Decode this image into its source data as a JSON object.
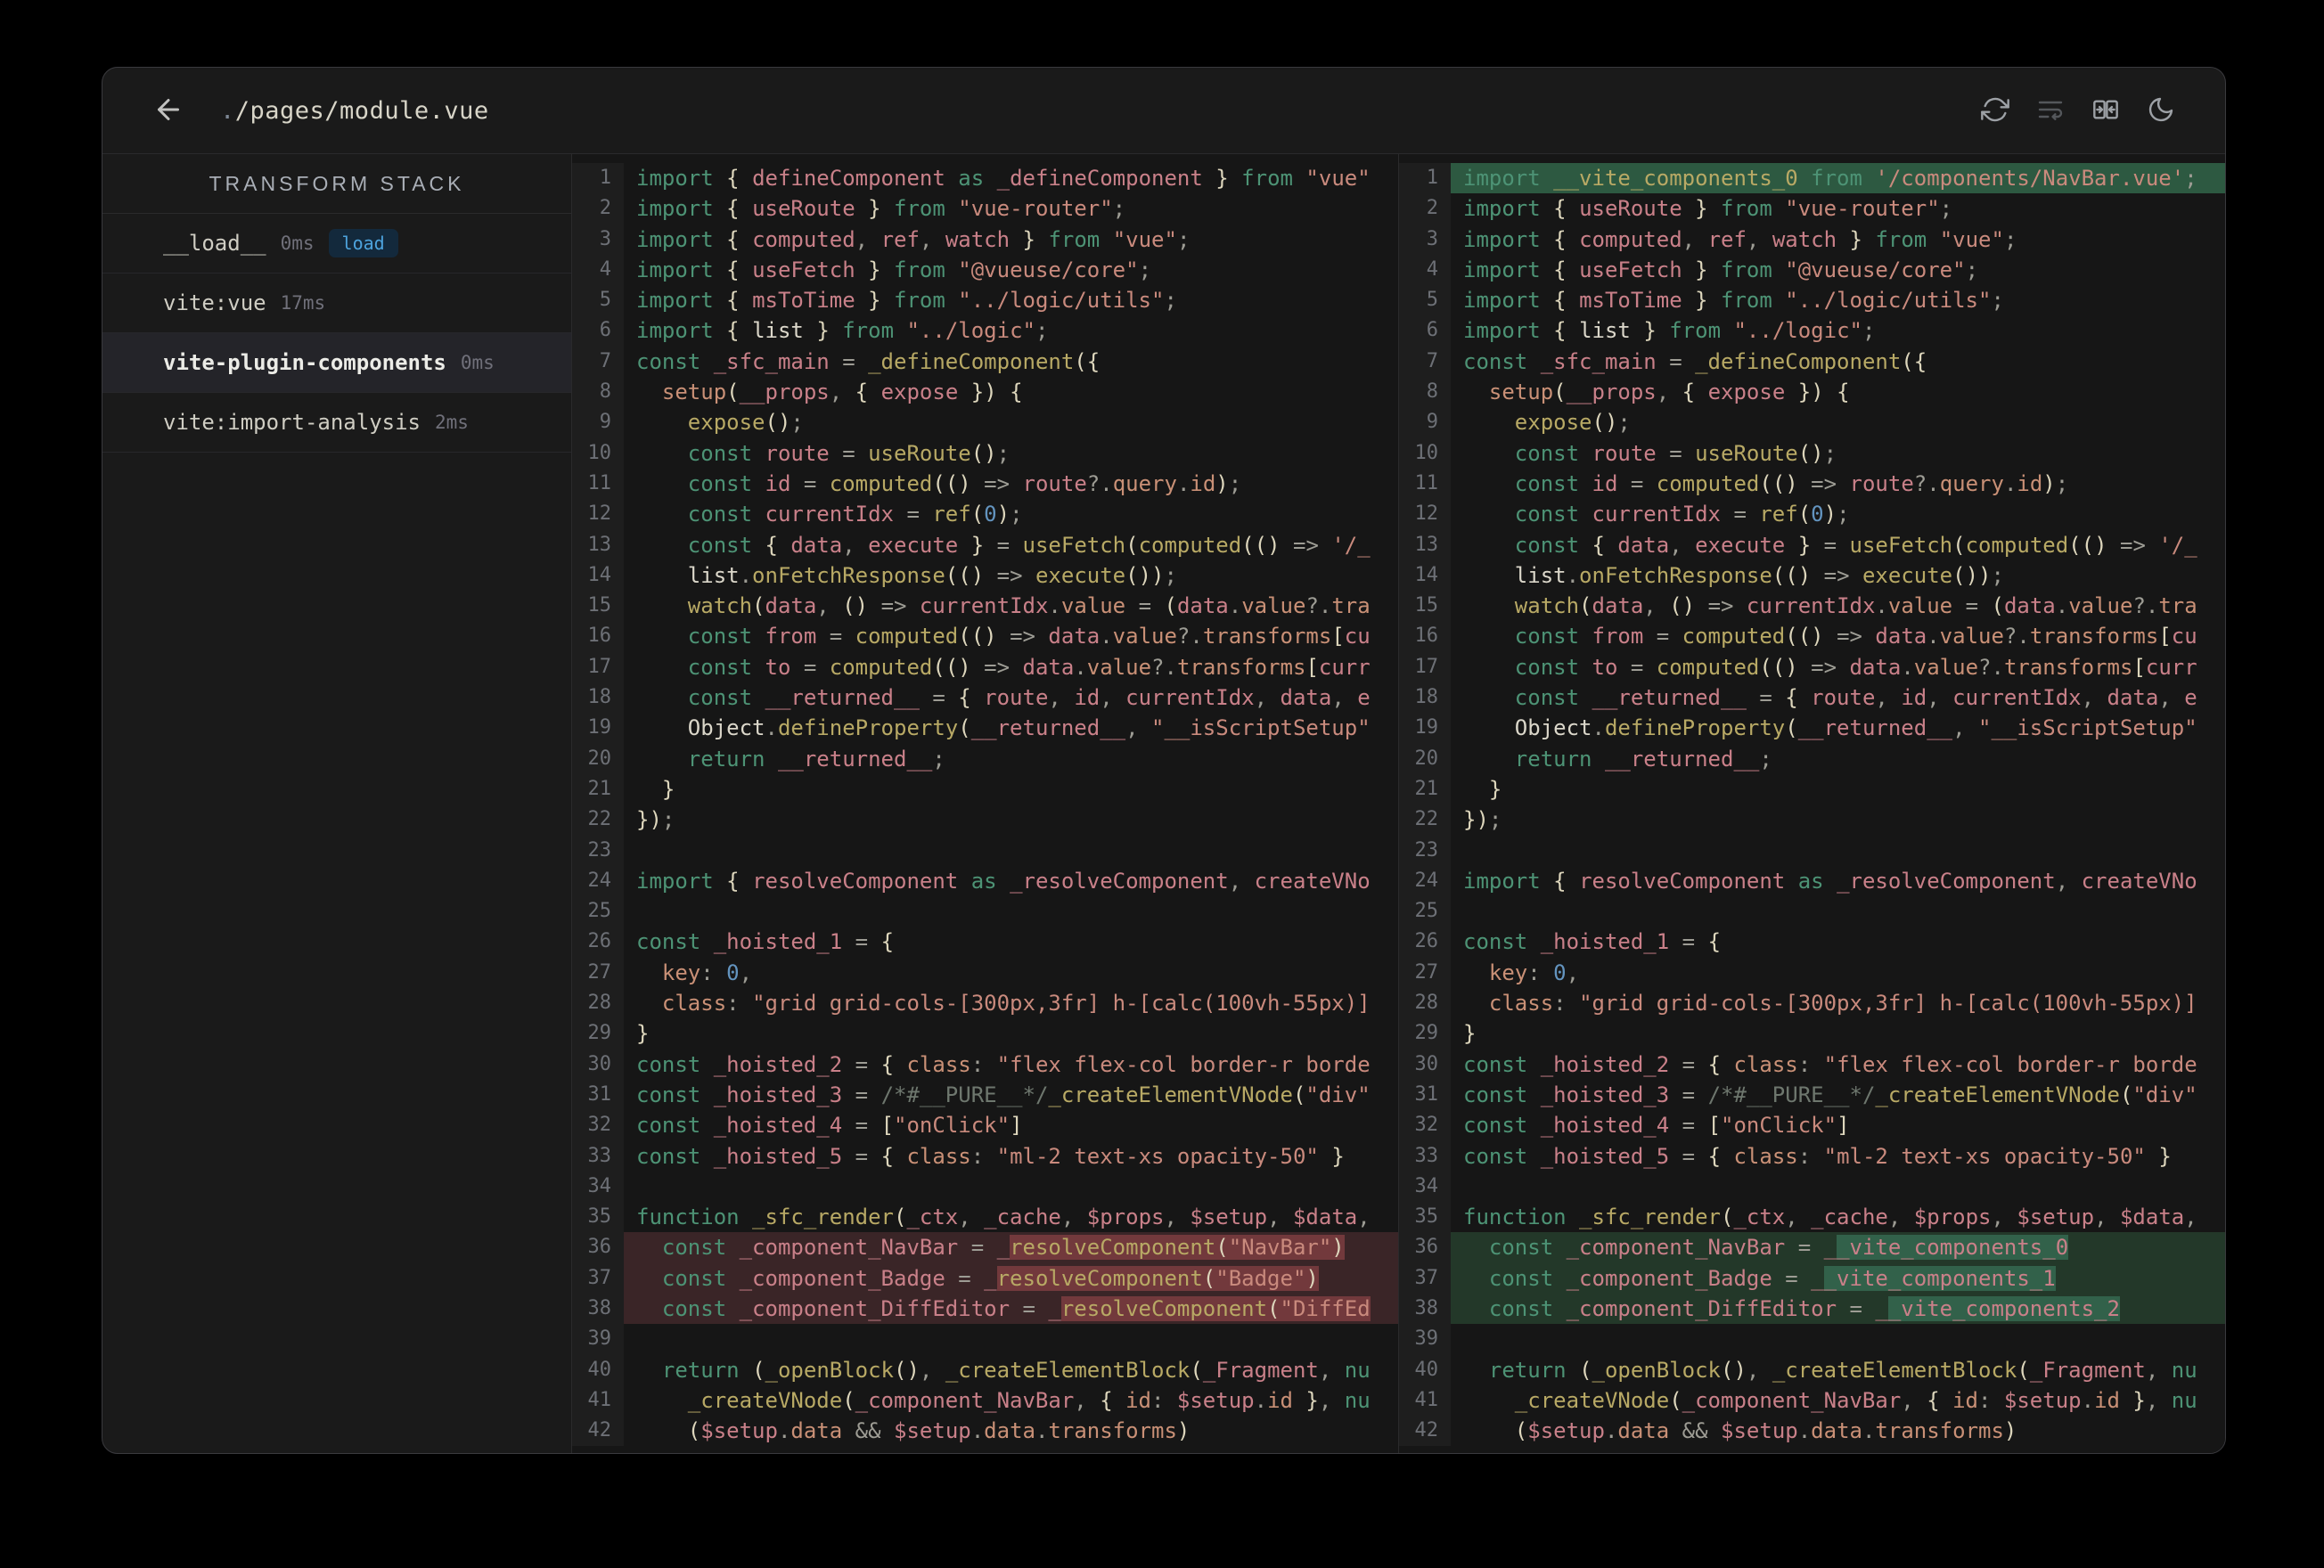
{
  "app": {
    "title_dot": ".",
    "title_path": "/pages/module.vue"
  },
  "header": {
    "back_icon": "arrow-left",
    "actions": [
      {
        "name": "refresh",
        "enabled": true
      },
      {
        "name": "wrap-text",
        "enabled": false
      },
      {
        "name": "diff-compare",
        "enabled": true
      },
      {
        "name": "dark-mode-moon",
        "enabled": true
      }
    ]
  },
  "sidebar": {
    "heading": "TRANSFORM STACK",
    "items": [
      {
        "name": "__load__",
        "time": "0ms",
        "badge": "load",
        "selected": false
      },
      {
        "name": "vite:vue",
        "time": "17ms",
        "badge": null,
        "selected": false
      },
      {
        "name": "vite-plugin-components",
        "time": "0ms",
        "badge": null,
        "selected": true
      },
      {
        "name": "vite:import-analysis",
        "time": "2ms",
        "badge": null,
        "selected": false
      }
    ]
  },
  "diff": {
    "left": {
      "lines": [
        "import { defineComponent as _defineComponent } from \"vue\"",
        "import { useRoute } from \"vue-router\";",
        "import { computed, ref, watch } from \"vue\";",
        "import { useFetch } from \"@vueuse/core\";",
        "import { msToTime } from \"../logic/utils\";",
        "import { list } from \"../logic\";",
        "const _sfc_main = _defineComponent({",
        "  setup(__props, { expose }) {",
        "    expose();",
        "    const route = useRoute();",
        "    const id = computed(() => route?.query.id);",
        "    const currentIdx = ref(0);",
        "    const { data, execute } = useFetch(computed(() => '/_",
        "    list.onFetchResponse(() => execute());",
        "    watch(data, () => currentIdx.value = (data.value?.tra",
        "    const from = computed(() => data.value?.transforms[cu",
        "    const to = computed(() => data.value?.transforms[curr",
        "    const __returned__ = { route, id, currentIdx, data, e",
        "    Object.defineProperty(__returned__, \"__isScriptSetup\"",
        "    return __returned__;",
        "  }",
        "});",
        "",
        "import { resolveComponent as _resolveComponent, createVNo",
        "",
        "const _hoisted_1 = {",
        "  key: 0,",
        "  class: \"grid grid-cols-[300px,3fr] h-[calc(100vh-55px)]",
        "}",
        "const _hoisted_2 = { class: \"flex flex-col border-r borde",
        "const _hoisted_3 = /*#__PURE__*/_createElementVNode(\"div\"",
        "const _hoisted_4 = [\"onClick\"]",
        "const _hoisted_5 = { class: \"ml-2 text-xs opacity-50\" }",
        "",
        "function _sfc_render(_ctx, _cache, $props, $setup, $data,",
        "  const _component_NavBar = _resolveComponent(\"NavBar\")",
        "  const _component_Badge = _resolveComponent(\"Badge\")",
        "  const _component_DiffEditor = _resolveComponent(\"DiffEd",
        "",
        "  return (_openBlock(), _createElementBlock(_Fragment, nu",
        "    _createVNode(_component_NavBar, { id: $setup.id }, nu",
        "    ($setup.data && $setup.data.transforms)"
      ],
      "line_highlights": {
        "36": "del",
        "37": "del",
        "38": "del"
      },
      "word_highlights": {
        "36": "resolveComponent(\"NavBar\")",
        "37": "resolveComponent(\"Badge\")",
        "38": "resolveComponent(\"DiffEd"
      }
    },
    "right": {
      "lines": [
        "import __vite_components_0 from '/components/NavBar.vue';",
        "import { useRoute } from \"vue-router\";",
        "import { computed, ref, watch } from \"vue\";",
        "import { useFetch } from \"@vueuse/core\";",
        "import { msToTime } from \"../logic/utils\";",
        "import { list } from \"../logic\";",
        "const _sfc_main = _defineComponent({",
        "  setup(__props, { expose }) {",
        "    expose();",
        "    const route = useRoute();",
        "    const id = computed(() => route?.query.id);",
        "    const currentIdx = ref(0);",
        "    const { data, execute } = useFetch(computed(() => '/_",
        "    list.onFetchResponse(() => execute());",
        "    watch(data, () => currentIdx.value = (data.value?.tra",
        "    const from = computed(() => data.value?.transforms[cu",
        "    const to = computed(() => data.value?.transforms[curr",
        "    const __returned__ = { route, id, currentIdx, data, e",
        "    Object.defineProperty(__returned__, \"__isScriptSetup\"",
        "    return __returned__;",
        "  }",
        "});",
        "",
        "import { resolveComponent as _resolveComponent, createVNo",
        "",
        "const _hoisted_1 = {",
        "  key: 0,",
        "  class: \"grid grid-cols-[300px,3fr] h-[calc(100vh-55px)]",
        "}",
        "const _hoisted_2 = { class: \"flex flex-col border-r borde",
        "const _hoisted_3 = /*#__PURE__*/_createElementVNode(\"div\"",
        "const _hoisted_4 = [\"onClick\"]",
        "const _hoisted_5 = { class: \"ml-2 text-xs opacity-50\" }",
        "",
        "function _sfc_render(_ctx, _cache, $props, $setup, $data,",
        "  const _component_NavBar = __vite_components_0",
        "  const _component_Badge = __vite_components_1",
        "  const _component_DiffEditor = __vite_components_2",
        "",
        "  return (_openBlock(), _createElementBlock(_Fragment, nu",
        "    _createVNode(_component_NavBar, { id: $setup.id }, nu",
        "    ($setup.data && $setup.data.transforms)"
      ],
      "line_highlights": {
        "1": "addf",
        "36": "add",
        "37": "add",
        "38": "add"
      },
      "word_highlights": {
        "36": "_vite_components_0",
        "37": "_vite_components_1",
        "38": "_vite_components_2"
      }
    }
  },
  "colors": {
    "badge_text": "#4da3dd",
    "badge_bg": "#13293c",
    "diff_del_line": "#3a2527",
    "diff_del_word": "#72393c",
    "diff_add_line": "#233829",
    "diff_add_word": "#32614a",
    "diff_add_full_line": "#2d5941",
    "syntax": {
      "keyword": "#4d9375",
      "string": "#c98a7d",
      "number": "#6394bf",
      "function": "#b8a965",
      "property": "#c99076",
      "variable": "#c98089",
      "foreground": "#dbd7ca",
      "operator": "#9d9c94",
      "bracket": "#ddd6bc",
      "comment": "#6e776e"
    }
  }
}
